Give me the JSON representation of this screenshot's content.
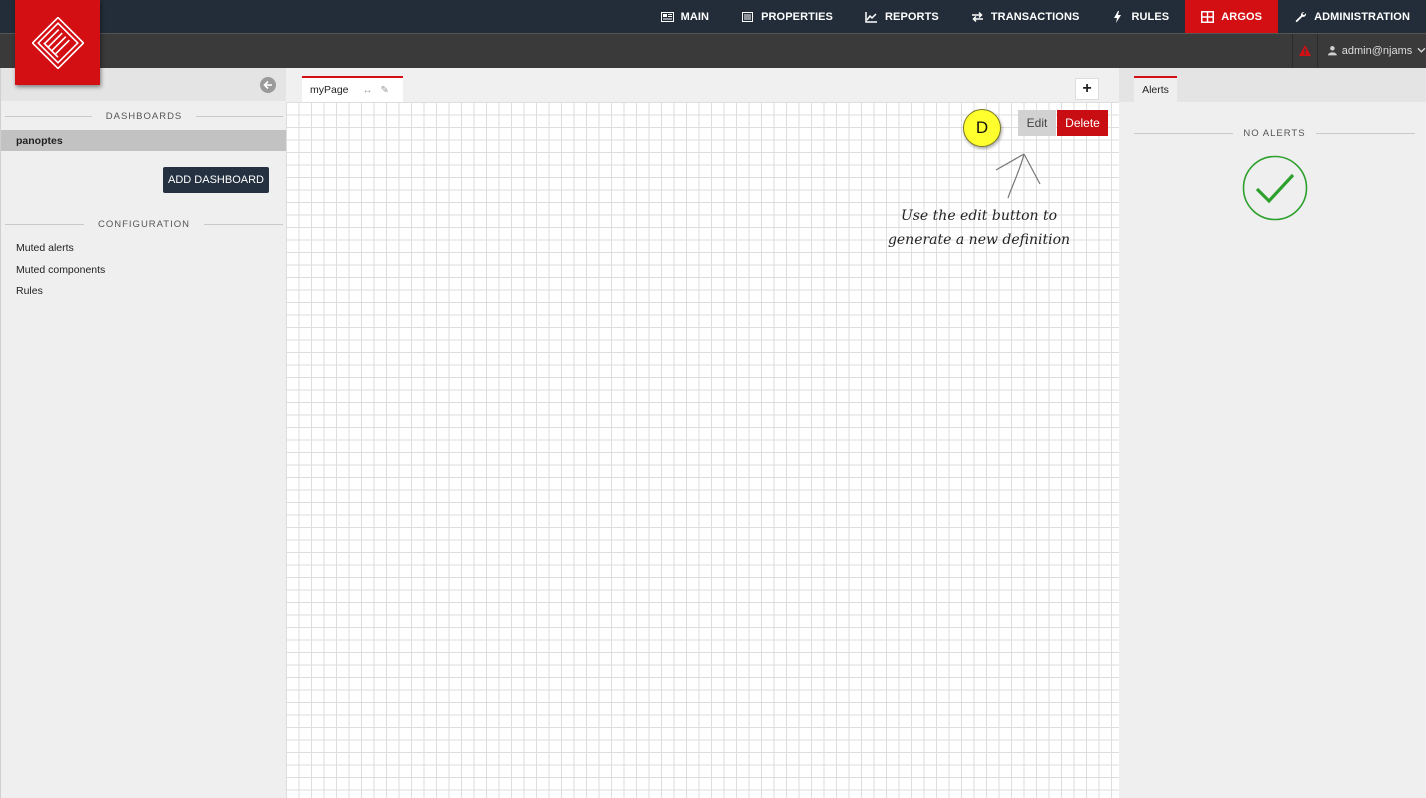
{
  "nav": {
    "items": [
      {
        "label": "MAIN",
        "icon": "newspaper-icon"
      },
      {
        "label": "PROPERTIES",
        "icon": "list-icon"
      },
      {
        "label": "REPORTS",
        "icon": "line-chart-icon"
      },
      {
        "label": "TRANSACTIONS",
        "icon": "exchange-icon"
      },
      {
        "label": "RULES",
        "icon": "bolt-icon"
      },
      {
        "label": "ARGOS",
        "icon": "dashboard-icon",
        "active": true
      },
      {
        "label": "ADMINISTRATION",
        "icon": "wrench-icon"
      }
    ],
    "accent_color": "#d40f14",
    "bar_color": "#222d39"
  },
  "user": {
    "name": "admin@njams"
  },
  "sidebar": {
    "dashboards_title": "DASHBOARDS",
    "dashboards": [
      {
        "label": "panoptes",
        "selected": true
      }
    ],
    "add_button": "ADD DASHBOARD",
    "configuration_title": "CONFIGURATION",
    "config_links": [
      "Muted alerts",
      "Muted components",
      "Rules"
    ]
  },
  "main": {
    "tab_label": "myPage",
    "add_tab": "+",
    "edit_label": "Edit",
    "delete_label": "Delete",
    "hint_line1": "Use the edit button to",
    "hint_line2": "generate a new definition",
    "marker": "D"
  },
  "alerts": {
    "tab_label": "Alerts",
    "status": "NO ALERTS",
    "ok_color": "#2ea02e"
  }
}
